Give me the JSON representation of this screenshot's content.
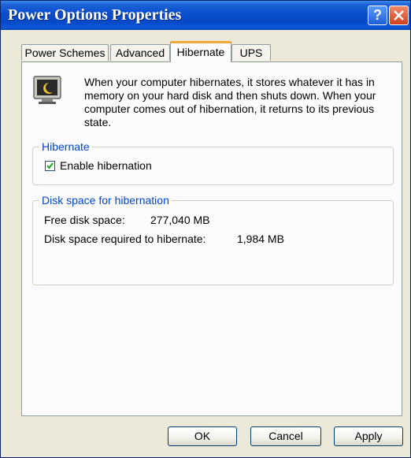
{
  "window": {
    "title": "Power Options Properties",
    "help_label": "?",
    "titlebar_color": "#0a4fd0",
    "close_color": "#d2401e"
  },
  "tabs": [
    {
      "label": "Power Schemes",
      "active": false
    },
    {
      "label": "Advanced",
      "active": false
    },
    {
      "label": "Hibernate",
      "active": true
    },
    {
      "label": "UPS",
      "active": false
    }
  ],
  "description": {
    "icon": "monitor-hibernate-icon",
    "text": "When your computer hibernates, it stores whatever it has in memory on your hard disk and then shuts down. When your computer comes out of hibernation, it returns to its previous state."
  },
  "hibernate_group": {
    "legend": "Hibernate",
    "checkbox_label": "Enable hibernation",
    "checked": true
  },
  "disk_group": {
    "legend": "Disk space for hibernation",
    "free_label": "Free disk space:",
    "free_value": "277,040 MB",
    "required_label": "Disk space required to hibernate:",
    "required_value": "1,984 MB"
  },
  "buttons": {
    "ok": "OK",
    "cancel": "Cancel",
    "apply": "Apply"
  },
  "colors": {
    "group_legend": "#0046d5",
    "active_tab_accent": "#f3a83a",
    "dialog_bg": "#ece9d8"
  }
}
